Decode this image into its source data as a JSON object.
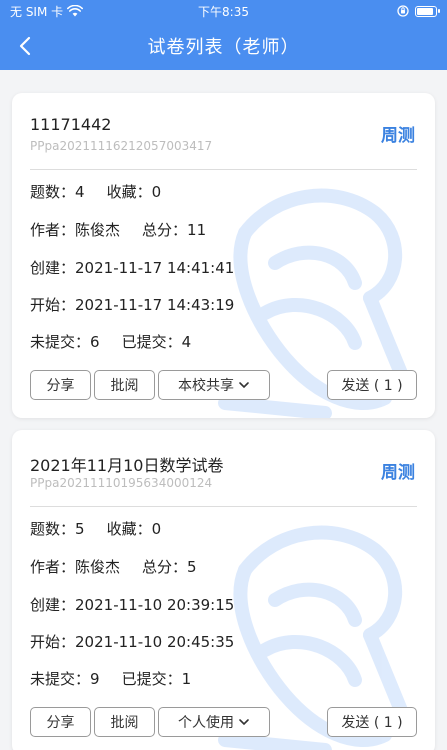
{
  "status_bar": {
    "carrier": "无 SIM 卡",
    "time": "下午8:35"
  },
  "navbar": {
    "title": "试卷列表（老师）"
  },
  "papers": [
    {
      "name": "11171442",
      "code": "PPpa20211116212057003417",
      "tag": "周测",
      "question_count_label": "题数：",
      "question_count": "4",
      "favorites_label": "收藏：",
      "favorites": "0",
      "author_label": "作者：",
      "author": "陈俊杰",
      "total_score_label": "总分：",
      "total_score": "11",
      "created_label": "创建：",
      "created": "2021-11-17 14:41:41",
      "start_label": "开始：",
      "start": "2021-11-17 14:43:19",
      "unsubmitted_label": "未提交：",
      "unsubmitted": "6",
      "submitted_label": "已提交：",
      "submitted": "4",
      "share_button": "分享",
      "review_button": "批阅",
      "scope_dropdown": "本校共享",
      "send_button": "发送 ( 1 )"
    },
    {
      "name": "2021年11月10日数学试卷",
      "code": "PPpa20211110195634000124",
      "tag": "周测",
      "question_count_label": "题数：",
      "question_count": "5",
      "favorites_label": "收藏：",
      "favorites": "0",
      "author_label": "作者：",
      "author": "陈俊杰",
      "total_score_label": "总分：",
      "total_score": "5",
      "created_label": "创建：",
      "created": "2021-11-10 20:39:15",
      "start_label": "开始：",
      "start": "2021-11-10 20:45:35",
      "unsubmitted_label": "未提交：",
      "unsubmitted": "9",
      "submitted_label": "已提交：",
      "submitted": "1",
      "share_button": "分享",
      "review_button": "批阅",
      "scope_dropdown": "个人使用",
      "send_button": "发送 ( 1 )"
    }
  ],
  "icons": {
    "back": "chevron-left-icon",
    "wifi": "wifi-icon",
    "lock": "orientation-lock-icon",
    "battery": "battery-icon",
    "watermark": "scroll-icon",
    "dropdown": "chevron-down-icon"
  },
  "colors": {
    "header": "#4a8ef0",
    "tag": "#3b82e0"
  }
}
